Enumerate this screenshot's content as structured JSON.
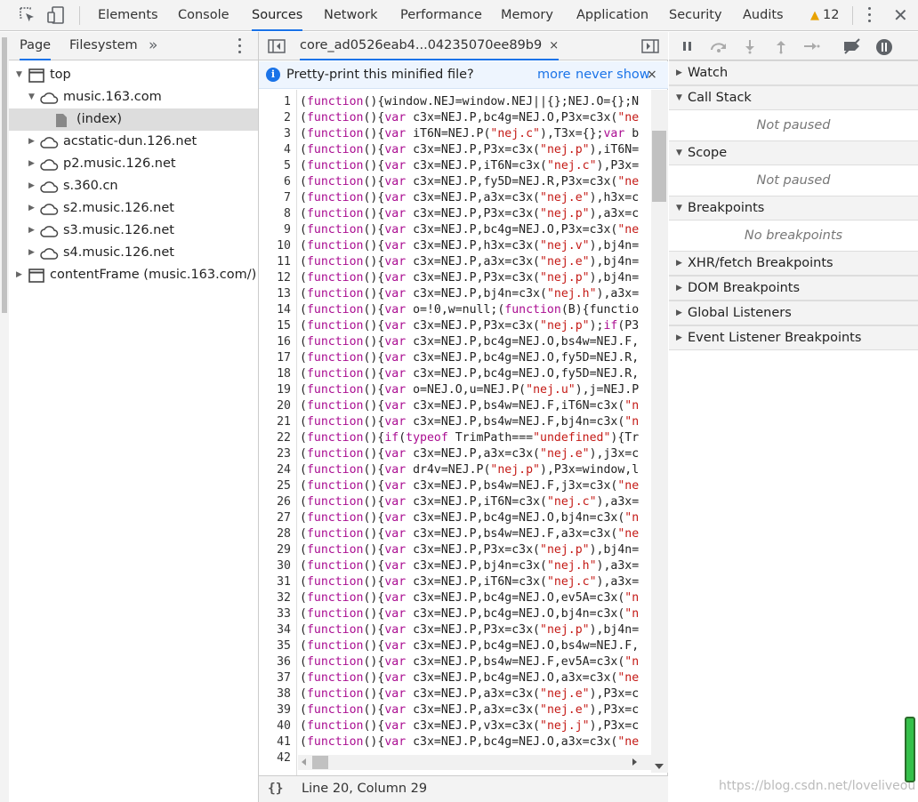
{
  "toolbar": {
    "tabs": [
      {
        "label": "Elements",
        "active": false
      },
      {
        "label": "Console",
        "active": false
      },
      {
        "label": "Sources",
        "active": true
      },
      {
        "label": "Network",
        "active": false
      },
      {
        "label": "Performance",
        "active": false
      },
      {
        "label": "Memory",
        "active": false
      },
      {
        "label": "Application",
        "active": false
      },
      {
        "label": "Security",
        "active": false
      },
      {
        "label": "Audits",
        "active": false
      }
    ],
    "warning_count": "12",
    "icons": [
      "inspect-icon",
      "device-toggle-icon",
      "warning-icon",
      "more-icon",
      "close-icon"
    ]
  },
  "navigator": {
    "tabs": [
      {
        "label": "Page",
        "active": true
      },
      {
        "label": "Filesystem",
        "active": false
      }
    ],
    "more_tabs_glyph": "»",
    "tree": [
      {
        "label": "top",
        "icon": "frame-icon",
        "expanded": true,
        "depth": 0
      },
      {
        "label": "music.163.com",
        "icon": "cloud-icon",
        "expanded": true,
        "depth": 1
      },
      {
        "label": "(index)",
        "icon": "file-icon",
        "selected": true,
        "depth": 2
      },
      {
        "label": "acstatic-dun.126.net",
        "icon": "cloud-icon",
        "expanded": false,
        "depth": 1
      },
      {
        "label": "p2.music.126.net",
        "icon": "cloud-icon",
        "expanded": false,
        "depth": 1
      },
      {
        "label": "s.360.cn",
        "icon": "cloud-icon",
        "expanded": false,
        "depth": 1
      },
      {
        "label": "s2.music.126.net",
        "icon": "cloud-icon",
        "expanded": false,
        "depth": 1
      },
      {
        "label": "s3.music.126.net",
        "icon": "cloud-icon",
        "expanded": false,
        "depth": 1
      },
      {
        "label": "s4.music.126.net",
        "icon": "cloud-icon",
        "expanded": false,
        "depth": 1
      },
      {
        "label": "contentFrame (music.163.com/)",
        "icon": "frame-icon",
        "expanded": false,
        "depth": 0
      }
    ]
  },
  "editor": {
    "file_tab": "core_ad0526eab4...04235070ee89b9",
    "close_glyph": "×",
    "infobar": {
      "message": "Pretty-print this minified file?",
      "more": "more",
      "never_show": "never show",
      "close": "×"
    },
    "lines": [
      {
        "n": "1",
        "text": "(function(){window.NEJ=window.NEJ||{};NEJ.O={};N"
      },
      {
        "n": "2",
        "text": "(function(){var c3x=NEJ.P,bc4g=NEJ.O,P3x=c3x(\"ne"
      },
      {
        "n": "3",
        "text": "(function(){var iT6N=NEJ.P(\"nej.c\"),T3x={};var b"
      },
      {
        "n": "4",
        "text": "(function(){var c3x=NEJ.P,P3x=c3x(\"nej.p\"),iT6N="
      },
      {
        "n": "5",
        "text": "(function(){var c3x=NEJ.P,iT6N=c3x(\"nej.c\"),P3x="
      },
      {
        "n": "6",
        "text": "(function(){var c3x=NEJ.P,fy5D=NEJ.R,P3x=c3x(\"ne"
      },
      {
        "n": "7",
        "text": "(function(){var c3x=NEJ.P,a3x=c3x(\"nej.e\"),h3x=c"
      },
      {
        "n": "8",
        "text": "(function(){var c3x=NEJ.P,P3x=c3x(\"nej.p\"),a3x=c"
      },
      {
        "n": "9",
        "text": "(function(){var c3x=NEJ.P,bc4g=NEJ.O,P3x=c3x(\"ne"
      },
      {
        "n": "10",
        "text": "(function(){var c3x=NEJ.P,h3x=c3x(\"nej.v\"),bj4n="
      },
      {
        "n": "11",
        "text": "(function(){var c3x=NEJ.P,a3x=c3x(\"nej.e\"),bj4n="
      },
      {
        "n": "12",
        "text": "(function(){var c3x=NEJ.P,P3x=c3x(\"nej.p\"),bj4n="
      },
      {
        "n": "13",
        "text": "(function(){var c3x=NEJ.P,bj4n=c3x(\"nej.h\"),a3x="
      },
      {
        "n": "14",
        "text": "(function(){var o=!0,w=null;(function(B){functio"
      },
      {
        "n": "15",
        "text": "(function(){var c3x=NEJ.P,P3x=c3x(\"nej.p\");if(P3"
      },
      {
        "n": "16",
        "text": "(function(){var c3x=NEJ.P,bc4g=NEJ.O,bs4w=NEJ.F,"
      },
      {
        "n": "17",
        "text": "(function(){var c3x=NEJ.P,bc4g=NEJ.O,fy5D=NEJ.R,"
      },
      {
        "n": "18",
        "text": "(function(){var c3x=NEJ.P,bc4g=NEJ.O,fy5D=NEJ.R,"
      },
      {
        "n": "19",
        "text": "(function(){var o=NEJ.O,u=NEJ.P(\"nej.u\"),j=NEJ.P"
      },
      {
        "n": "20",
        "text": "(function(){var c3x=NEJ.P,bs4w=NEJ.F,iT6N=c3x(\"n"
      },
      {
        "n": "21",
        "text": "(function(){var c3x=NEJ.P,bs4w=NEJ.F,bj4n=c3x(\"n"
      },
      {
        "n": "22",
        "text": "(function(){if(typeof TrimPath===\"undefined\"){Tr"
      },
      {
        "n": "23",
        "text": "(function(){var c3x=NEJ.P,a3x=c3x(\"nej.e\"),j3x=c"
      },
      {
        "n": "24",
        "text": "(function(){var dr4v=NEJ.P(\"nej.p\"),P3x=window,l"
      },
      {
        "n": "25",
        "text": "(function(){var c3x=NEJ.P,bs4w=NEJ.F,j3x=c3x(\"ne"
      },
      {
        "n": "26",
        "text": "(function(){var c3x=NEJ.P,iT6N=c3x(\"nej.c\"),a3x="
      },
      {
        "n": "27",
        "text": "(function(){var c3x=NEJ.P,bc4g=NEJ.O,bj4n=c3x(\"n"
      },
      {
        "n": "28",
        "text": "(function(){var c3x=NEJ.P,bs4w=NEJ.F,a3x=c3x(\"ne"
      },
      {
        "n": "29",
        "text": "(function(){var c3x=NEJ.P,P3x=c3x(\"nej.p\"),bj4n="
      },
      {
        "n": "30",
        "text": "(function(){var c3x=NEJ.P,bj4n=c3x(\"nej.h\"),a3x="
      },
      {
        "n": "31",
        "text": "(function(){var c3x=NEJ.P,iT6N=c3x(\"nej.c\"),a3x="
      },
      {
        "n": "32",
        "text": "(function(){var c3x=NEJ.P,bc4g=NEJ.O,ev5A=c3x(\"n"
      },
      {
        "n": "33",
        "text": "(function(){var c3x=NEJ.P,bc4g=NEJ.O,bj4n=c3x(\"n"
      },
      {
        "n": "34",
        "text": "(function(){var c3x=NEJ.P,P3x=c3x(\"nej.p\"),bj4n="
      },
      {
        "n": "35",
        "text": "(function(){var c3x=NEJ.P,bc4g=NEJ.O,bs4w=NEJ.F,"
      },
      {
        "n": "36",
        "text": "(function(){var c3x=NEJ.P,bs4w=NEJ.F,ev5A=c3x(\"n"
      },
      {
        "n": "37",
        "text": "(function(){var c3x=NEJ.P,bc4g=NEJ.O,a3x=c3x(\"ne"
      },
      {
        "n": "38",
        "text": "(function(){var c3x=NEJ.P,a3x=c3x(\"nej.e\"),P3x=c"
      },
      {
        "n": "39",
        "text": "(function(){var c3x=NEJ.P,a3x=c3x(\"nej.e\"),P3x=c"
      },
      {
        "n": "40",
        "text": "(function(){var c3x=NEJ.P,v3x=c3x(\"nej.j\"),P3x=c"
      },
      {
        "n": "41",
        "text": "(function(){var c3x=NEJ.P,bc4g=NEJ.O,a3x=c3x(\"ne"
      },
      {
        "n": "42",
        "text": ""
      }
    ],
    "status_braces": "{}",
    "cursor_position": "Line 20, Column 29"
  },
  "debugger": {
    "sections": [
      {
        "title": "Watch",
        "expanded": false
      },
      {
        "title": "Call Stack",
        "expanded": true,
        "empty": "Not paused"
      },
      {
        "title": "Scope",
        "expanded": true,
        "empty": "Not paused"
      },
      {
        "title": "Breakpoints",
        "expanded": true,
        "empty": "No breakpoints"
      },
      {
        "title": "XHR/fetch Breakpoints",
        "expanded": false
      },
      {
        "title": "DOM Breakpoints",
        "expanded": false
      },
      {
        "title": "Global Listeners",
        "expanded": false
      },
      {
        "title": "Event Listener Breakpoints",
        "expanded": false
      }
    ]
  },
  "watermark": "https://blog.csdn.net/loveliveou",
  "colors": {
    "accent": "#1a73e8",
    "keyword": "#aa0d91",
    "string": "#c41a16",
    "warning": "#e8a200"
  }
}
